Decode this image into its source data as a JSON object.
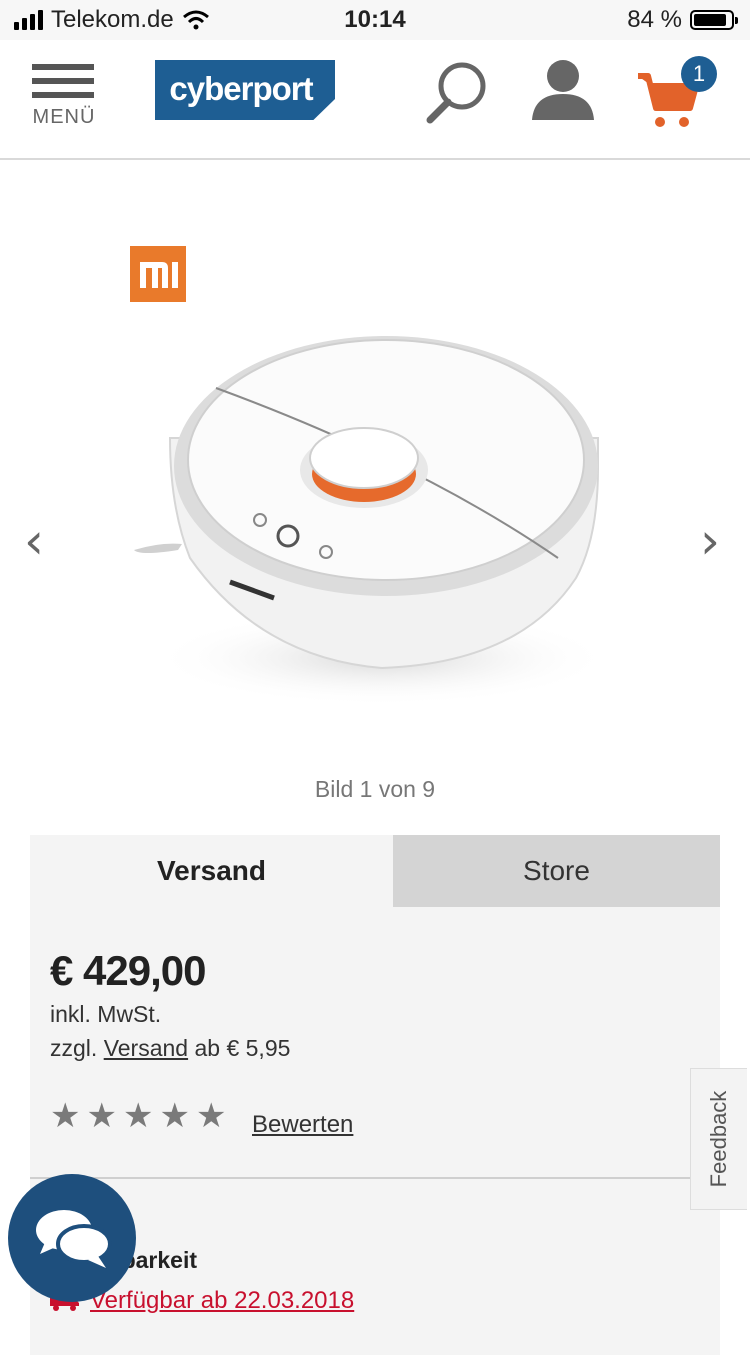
{
  "status_bar": {
    "carrier": "Telekom.de",
    "time": "10:14",
    "battery": "84 %"
  },
  "header": {
    "menu_label": "MENÜ",
    "logo_text": "cyberport",
    "cart_count": "1",
    "accent_color": "#1e5e93",
    "cart_color": "#e2622a"
  },
  "gallery": {
    "brand_logo_text": "MI",
    "caption": "Bild 1 von 9",
    "prev_icon": "chevron-left-icon",
    "next_icon": "chevron-right-icon"
  },
  "tabs": [
    {
      "label": "Versand",
      "active": true
    },
    {
      "label": "Store",
      "active": false
    }
  ],
  "offer": {
    "price": "€ 429,00",
    "vat_note": "inkl. MwSt.",
    "shipping_prefix": "zzgl.",
    "shipping_link": "Versand",
    "shipping_suffix": "ab € 5,95",
    "rating_stars": 5,
    "rating_link": "Bewerten",
    "availability_label": "Verfügbarkeit",
    "availability_link": "Verfügbar ab 22.03.2018"
  },
  "widgets": {
    "feedback_label": "Feedback",
    "chat_icon": "chat-bubbles-icon"
  }
}
